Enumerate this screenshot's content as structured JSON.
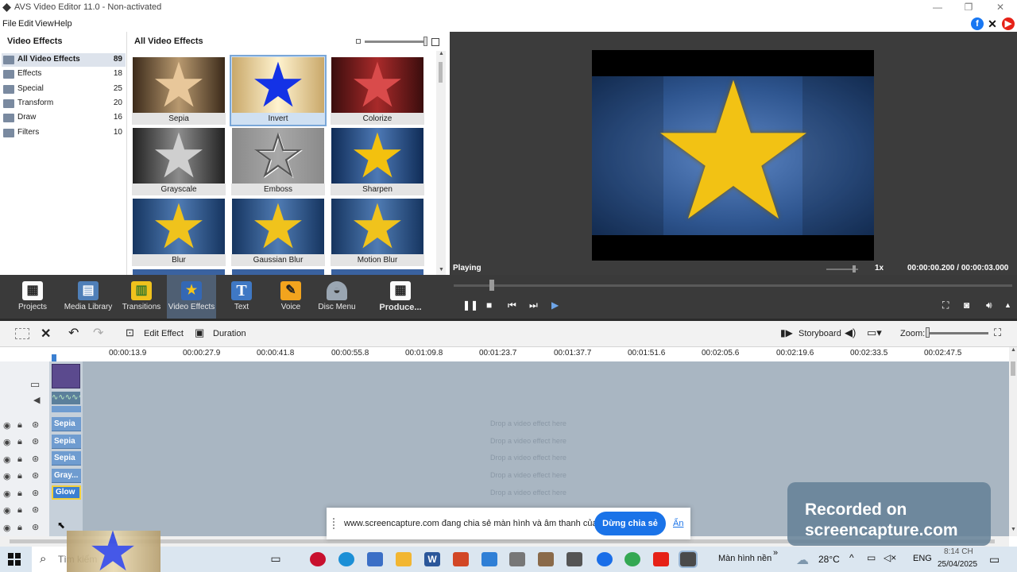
{
  "window": {
    "title": "AVS Video Editor 11.0 - Non-activated"
  },
  "menu": [
    "File",
    "Edit",
    "View",
    "Help"
  ],
  "social": [
    "facebook-icon",
    "x-icon",
    "youtube-icon"
  ],
  "colors": {
    "facebook": "#1877f2",
    "youtube": "#e62117",
    "accent": "#3b7fd1",
    "toolbar": "#3a3a3a",
    "clip": "#6f9cd0",
    "track": "#a9b6c2"
  },
  "left_pane": {
    "title": "Video Effects",
    "categories": [
      {
        "label": "All Video Effects",
        "count": "89",
        "selected": true
      },
      {
        "label": "Effects",
        "count": "18"
      },
      {
        "label": "Special",
        "count": "25"
      },
      {
        "label": "Transform",
        "count": "20"
      },
      {
        "label": "Draw",
        "count": "16"
      },
      {
        "label": "Filters",
        "count": "10"
      }
    ]
  },
  "gallery": {
    "title": "All Video Effects",
    "effects": [
      "Sepia",
      "Invert",
      "Colorize",
      "Grayscale",
      "Emboss",
      "Sharpen",
      "Blur",
      "Gaussian Blur",
      "Motion Blur"
    ],
    "selected": "Invert"
  },
  "preview": {
    "status": "Playing",
    "speed": "1x",
    "time": "00:00:00.200 / 00:00:03.000"
  },
  "modes": [
    {
      "label": "Projects",
      "icon": "clapperboard-icon"
    },
    {
      "label": "Media Library",
      "icon": "film-strip-icon"
    },
    {
      "label": "Transitions",
      "icon": "transitions-icon"
    },
    {
      "label": "Video Effects",
      "icon": "star-effects-icon",
      "active": true
    },
    {
      "label": "Text",
      "icon": "text-t-icon"
    },
    {
      "label": "Voice",
      "icon": "microphone-icon"
    },
    {
      "label": "Disc Menu",
      "icon": "disc-icon"
    },
    {
      "label": "Produce...",
      "icon": "produce-icon"
    }
  ],
  "timeline_toolbar": {
    "edit_effect": "Edit Effect",
    "duration": "Duration",
    "storyboard": "Storyboard",
    "zoom": "Zoom:"
  },
  "ruler": [
    "00:00:13.9",
    "00:00:27.9",
    "00:00:41.8",
    "00:00:55.8",
    "00:01:09.8",
    "00:01:23.7",
    "00:01:37.7",
    "00:01:51.6",
    "00:02:05.6",
    "00:02:19.6",
    "00:02:33.5",
    "00:02:47.5"
  ],
  "clips": [
    "Sepia",
    "Sepia",
    "Sepia",
    "Gray...",
    "Glow"
  ],
  "drop_hint": "Drop a video effect here",
  "share_bar": {
    "message": "www.screencapture.com đang chia sẻ màn hình và âm thanh của bạn.",
    "stop_button": "Dừng chia sẻ",
    "hide_link": "Ẩn"
  },
  "watermark": {
    "line1": "Recorded on",
    "line2": "screencapture.com"
  },
  "taskbar": {
    "search": "Tìm kiếm",
    "desktop_label": "Màn hình nền",
    "temperature": "28°C",
    "language": "ENG",
    "time": "8:14 CH",
    "date": "25/04/2025"
  }
}
